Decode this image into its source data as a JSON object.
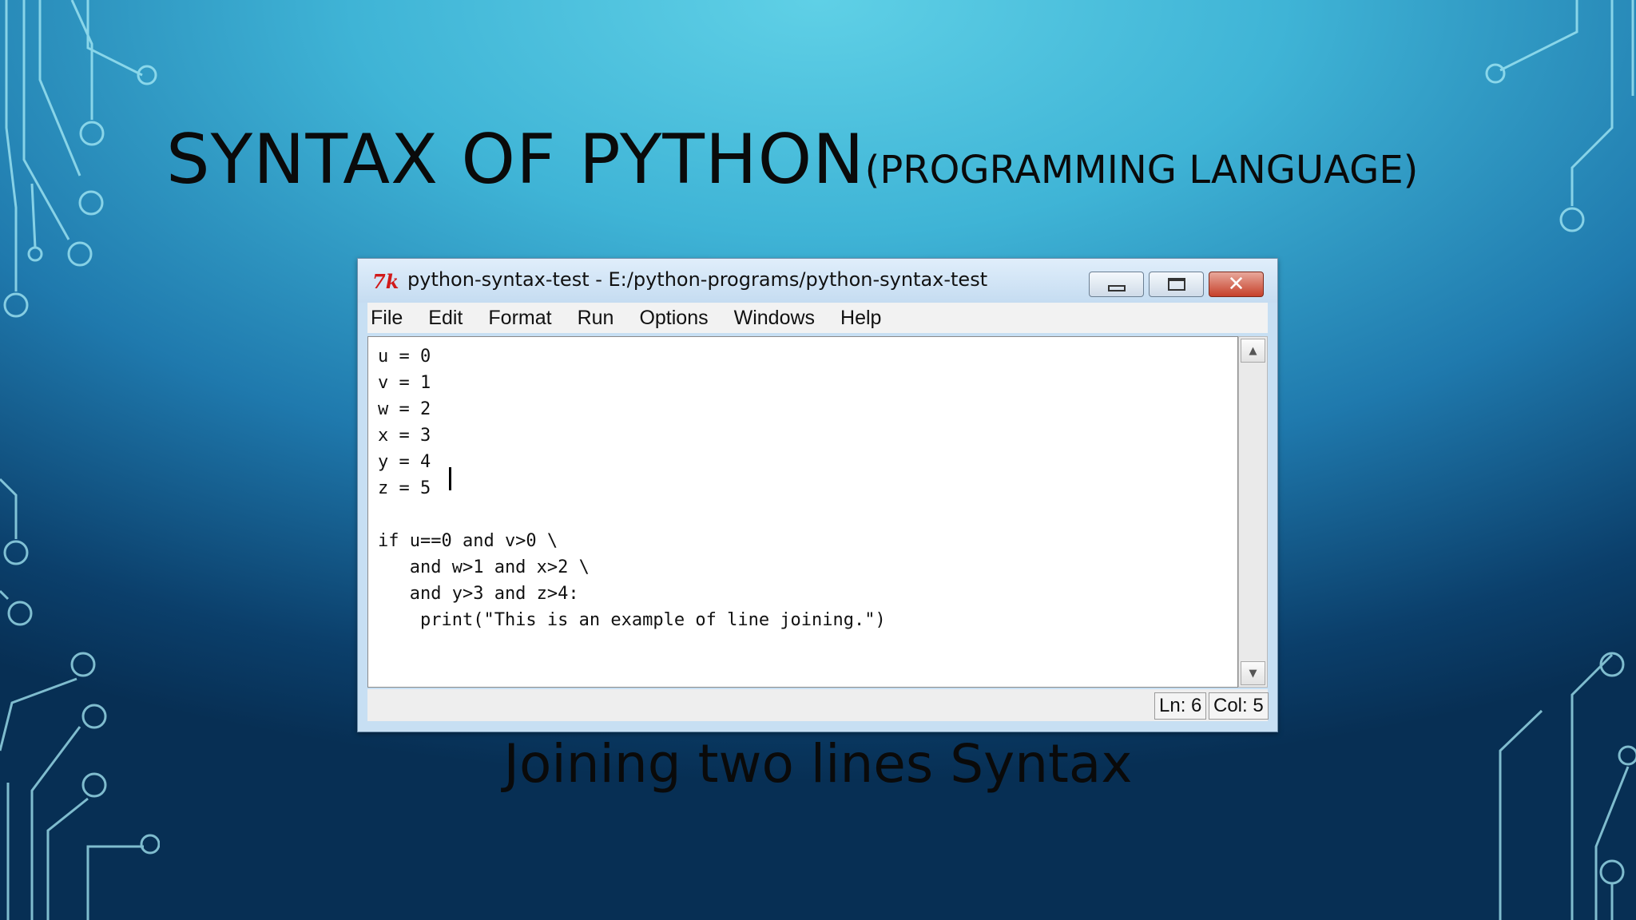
{
  "slide": {
    "title": "SYNTAX OF PYTHON",
    "subtitle": "(PROGRAMMING LANGUAGE)",
    "caption": "Joining two lines Syntax"
  },
  "window": {
    "icon": "tk-feather-icon",
    "title": "python-syntax-test - E:/python-programs/python-syntax-test",
    "buttons": {
      "minimize": "minimize-icon",
      "maximize": "maximize-icon",
      "close": "✕"
    }
  },
  "menu": {
    "items": [
      "File",
      "Edit",
      "Format",
      "Run",
      "Options",
      "Windows",
      "Help"
    ]
  },
  "editor": {
    "lines": [
      "u = 0",
      "v = 1",
      "w = 2",
      "x = 3",
      "y = 4",
      "z = 5",
      "",
      "if u==0 and v>0 \\",
      "   and w>1 and x>2 \\",
      "   and y>3 and z>4:",
      "    print(\"This is an example of line joining.\")"
    ]
  },
  "status": {
    "line": "Ln: 6",
    "col": "Col: 5"
  },
  "colors": {
    "bg_light": "#5fd0e6",
    "bg_dark": "#072f54",
    "circuit": "#a8ecf7",
    "close_button": "#c6402a"
  }
}
